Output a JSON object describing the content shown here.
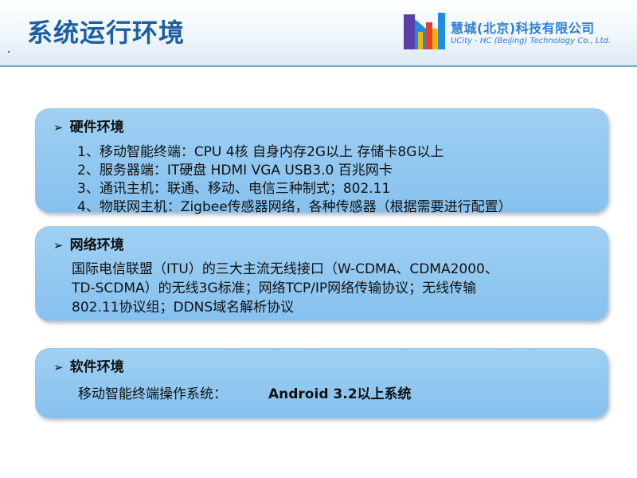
{
  "header": {
    "title": "系统运行环境",
    "company_cn": "慧城(北京)科技有限公司",
    "company_en": "UCity - HC (Beijing) Technology Co., Ltd."
  },
  "colors": {
    "title": "#1c5fa3",
    "panel": "#93c9f1",
    "logo_purple": "#5b3fa8",
    "logo_blue": "#1e8fe0",
    "logo_red": "#e8402a",
    "logo_yellow": "#f5b400"
  },
  "icons": {
    "bullet": "arrow-right-icon"
  },
  "sections": {
    "hardware": {
      "bullet": "➢",
      "heading": "硬件环境",
      "lines": [
        "1、移动智能终端：CPU  4核 自身内存2G以上 存储卡8G以上",
        "2、服务器端：IT硬盘  HDMI  VGA  USB3.0  百兆网卡",
        "3、通讯主机：联通、移动、电信三种制式；802.11",
        "4、物联网主机：Zigbee传感器网络，各种传感器（根据需要进行配置）"
      ]
    },
    "network": {
      "bullet": "➢",
      "heading": "网络环境",
      "lines": [
        "国际电信联盟（ITU）的三大主流无线接口（W-CDMA、CDMA2000、",
        "TD-SCDMA）的无线3G标准；网络TCP/IP网络传输协议；无线传输",
        "802.11协议组；DDNS域名解析协议"
      ]
    },
    "software": {
      "bullet": "➢",
      "heading": "软件环境",
      "label": "移动智能终端操作系统：",
      "value": "Android 3.2以上系统"
    }
  }
}
